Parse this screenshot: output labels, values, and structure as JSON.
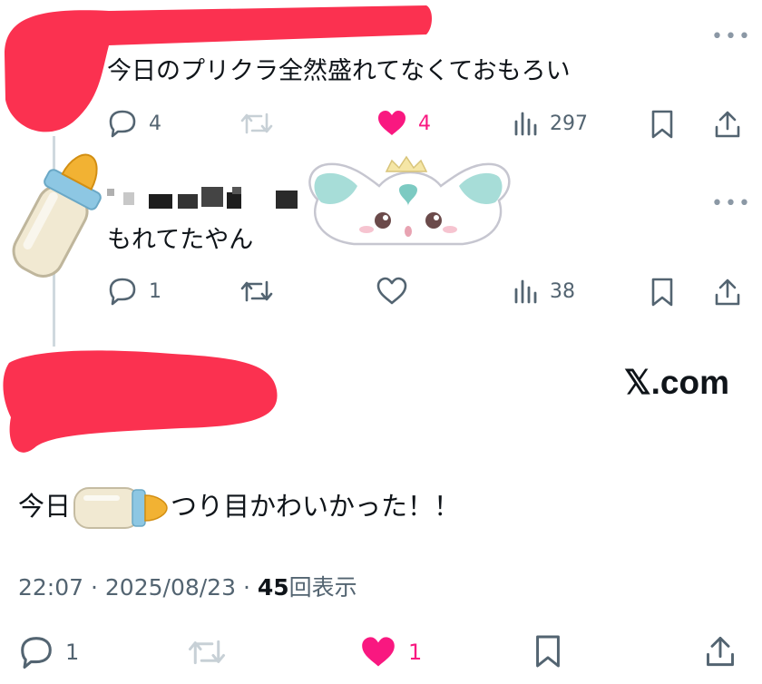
{
  "colors": {
    "redaction": "#fb3150",
    "like": "#f91880",
    "muted": "#536471"
  },
  "tweet1": {
    "text": "今日のプリクラ全然盛れてなくておもろい",
    "reply_count": "4",
    "like_count": "4",
    "view_count": "297",
    "more_icon": "more-horizontal-icon"
  },
  "tweet2": {
    "text": "もれてたやん",
    "reply_count": "1",
    "view_count": "38",
    "more_icon": "more-horizontal-icon"
  },
  "main_tweet": {
    "text_before": "今日",
    "text_after": "つり目かわいかった！！",
    "watermark": "𝕏.com",
    "time": "22:07",
    "date": "2025/08/23",
    "separator": "·",
    "view_count": "45",
    "view_label": "回表示",
    "reply_count": "1",
    "like_count": "1"
  },
  "stickers": [
    "baby-bottle-sticker",
    "white-mascot-sticker"
  ]
}
